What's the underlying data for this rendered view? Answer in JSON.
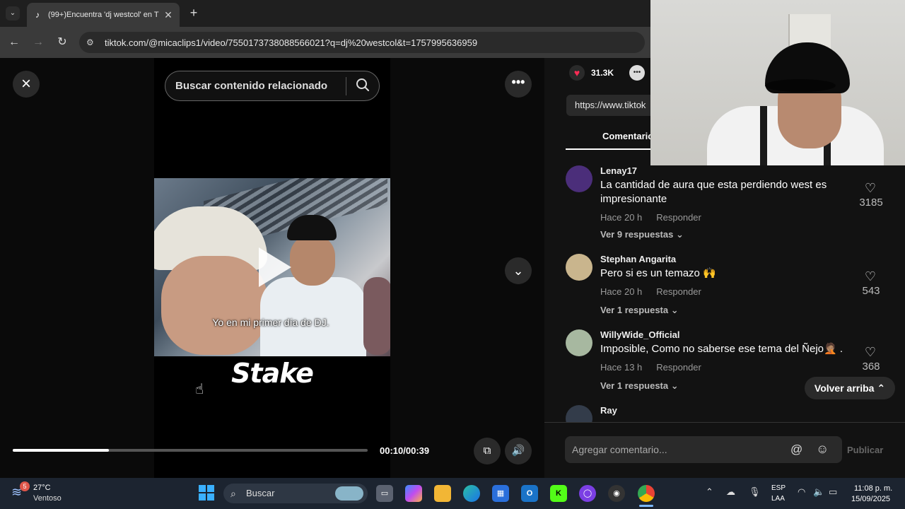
{
  "browser": {
    "tab_title": "(99+)Encuentra 'dj westcol' en T",
    "tab_close": "✕",
    "new_tab": "+",
    "url": "tiktok.com/@micaclips1/video/7550173738088566021?q=dj%20westcol&t=1757995636959"
  },
  "viewer": {
    "search_placeholder": "Buscar contenido relacionado",
    "caption": "Yo en mi primer día de DJ.",
    "watermark": "Stake",
    "time": "00:10/00:39",
    "progress": 0.27
  },
  "panel": {
    "likes": "31.3K",
    "link": "https://www.tiktok",
    "tab": "Comentarios",
    "comments": [
      {
        "user": "Lenay17",
        "text": "La cantidad de aura que esta perdiendo west es impresionante",
        "time": "Hace 20 h",
        "reply": "Responder",
        "replies": "Ver 9 respuestas",
        "likes": "3185",
        "avatar_color": "#4b2e7a"
      },
      {
        "user": "Stephan Angarita",
        "text": "Pero si es un temazo 🙌",
        "time": "Hace 20 h",
        "reply": "Responder",
        "replies": "Ver 1 respuesta",
        "likes": "543",
        "avatar_color": "#c9b58d"
      },
      {
        "user": "WillyWide_Official",
        "text": "Imposible, Como no saberse ese tema del Ñejo🤦🏽 .",
        "time": "Hace 13 h",
        "reply": "Responder",
        "replies": "Ver 1 respuesta",
        "likes": "368",
        "avatar_color": "#a7b8a0"
      },
      {
        "user": "Ray",
        "avatar_color": "#333c4a"
      }
    ],
    "back_to_top": "Volver arriba",
    "comment_placeholder": "Agregar comentario...",
    "publish": "Publicar"
  },
  "taskbar": {
    "weather_badge": "5",
    "temperature": "27°C",
    "condition": "Ventoso",
    "search": "Buscar",
    "lang1": "ESP",
    "lang2": "LAA",
    "time": "11:08 p. m.",
    "date": "15/09/2025"
  }
}
